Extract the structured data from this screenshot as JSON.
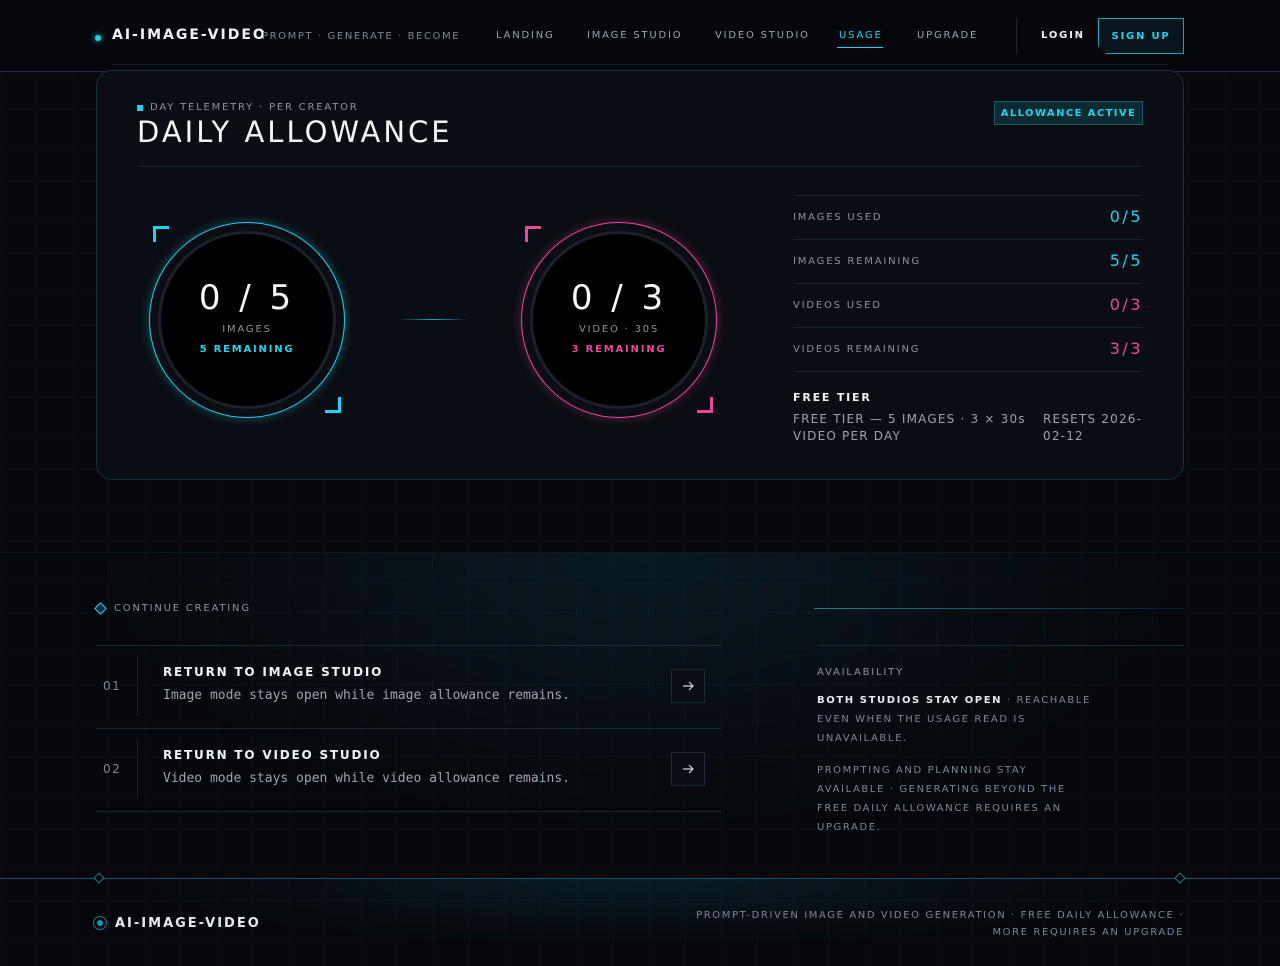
{
  "nav": {
    "brand": "AI-IMAGE-VIDEO",
    "tagline": "PROMPT · GENERATE · BECOME",
    "links": [
      "LANDING",
      "IMAGE STUDIO",
      "VIDEO STUDIO",
      "USAGE",
      "UPGRADE"
    ],
    "active": "USAGE",
    "login": "LOGIN",
    "signup": "SIGN UP"
  },
  "allowance": {
    "eyebrow": "DAY TELEMETRY · PER CREATOR",
    "title": "DAILY ALLOWANCE",
    "badge": "ALLOWANCE ACTIVE",
    "image_gauge": {
      "value": "0 / 5",
      "label": "IMAGES",
      "remaining": "5 REMAINING",
      "used": 0,
      "total": 5
    },
    "video_gauge": {
      "value": "0 / 3",
      "label": "VIDEO · 30S",
      "remaining": "3 REMAINING",
      "used": 0,
      "total": 3
    },
    "stats": [
      {
        "label": "IMAGES USED",
        "value": "0/5"
      },
      {
        "label": "IMAGES REMAINING",
        "value": "5/5"
      },
      {
        "label": "VIDEOS USED",
        "value": "0/3"
      },
      {
        "label": "VIDEOS REMAINING",
        "value": "3/3"
      }
    ],
    "tier_title": "FREE TIER",
    "tier_desc": "FREE TIER — 5 IMAGES · 3 × 30s VIDEO PER DAY",
    "resets": "RESETS 2026-02-12"
  },
  "continue": {
    "label": "CONTINUE CREATING",
    "items": [
      {
        "num": "01",
        "title": "RETURN TO IMAGE STUDIO",
        "desc": "Image mode stays open while image allowance remains."
      },
      {
        "num": "02",
        "title": "RETURN TO VIDEO STUDIO",
        "desc": "Video mode stays open while video allowance remains."
      }
    ]
  },
  "availability": {
    "label": "AVAILABILITY",
    "p1_strong": "BOTH STUDIOS STAY OPEN",
    "p1_rest": " · REACHABLE EVEN WHEN THE USAGE READ IS UNAVAILABLE.",
    "p2": "PROMPTING AND PLANNING STAY AVAILABLE · GENERATING BEYOND THE FREE DAILY ALLOWANCE REQUIRES AN UPGRADE."
  },
  "footer": {
    "brand": "AI-IMAGE-VIDEO",
    "text": "PROMPT-DRIVEN IMAGE AND VIDEO GENERATION · FREE DAILY ALLOWANCE · MORE REQUIRES AN UPGRADE"
  },
  "colors": {
    "cyan": "#22d3ee",
    "magenta": "#ec4899"
  }
}
